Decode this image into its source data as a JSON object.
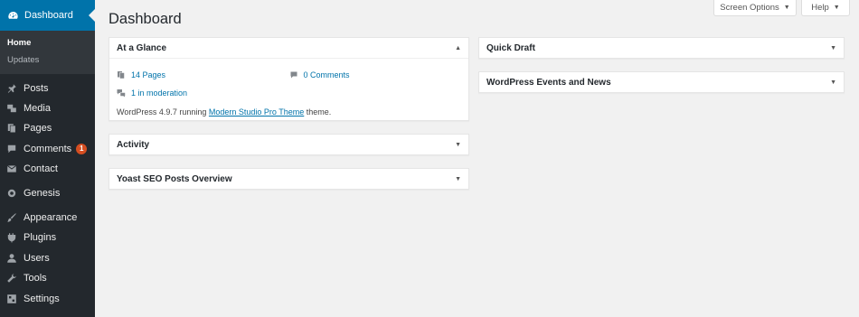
{
  "sidebar": {
    "dashboard_label": "Dashboard",
    "submenu": [
      "Home",
      "Updates"
    ],
    "items": [
      {
        "label": "Posts",
        "icon": "pin-icon"
      },
      {
        "label": "Media",
        "icon": "media-icon"
      },
      {
        "label": "Pages",
        "icon": "pages-icon"
      },
      {
        "label": "Comments",
        "icon": "comment-icon",
        "badge": "1"
      },
      {
        "label": "Contact",
        "icon": "mail-icon"
      },
      {
        "label": "Genesis",
        "icon": "genesis-icon"
      },
      {
        "label": "Appearance",
        "icon": "brush-icon"
      },
      {
        "label": "Plugins",
        "icon": "plug-icon"
      },
      {
        "label": "Users",
        "icon": "user-icon"
      },
      {
        "label": "Tools",
        "icon": "wrench-icon"
      },
      {
        "label": "Settings",
        "icon": "settings-icon"
      }
    ]
  },
  "header": {
    "title": "Dashboard",
    "screen_options": "Screen Options",
    "help": "Help"
  },
  "widgets": {
    "at_a_glance": {
      "title": "At a Glance",
      "pages": "14 Pages",
      "comments": "0 Comments",
      "moderation": "1 in moderation",
      "version_prefix": "WordPress 4.9.7 running ",
      "theme": "Modern Studio Pro Theme",
      "version_suffix": " theme."
    },
    "activity": {
      "title": "Activity"
    },
    "yoast": {
      "title": "Yoast SEO Posts Overview"
    },
    "quick_draft": {
      "title": "Quick Draft"
    },
    "events": {
      "title": "WordPress Events and News"
    }
  },
  "colors": {
    "sidebar_bg": "#23282d",
    "accent": "#0073aa",
    "badge": "#d54e21",
    "page_bg": "#f1f1f1"
  }
}
